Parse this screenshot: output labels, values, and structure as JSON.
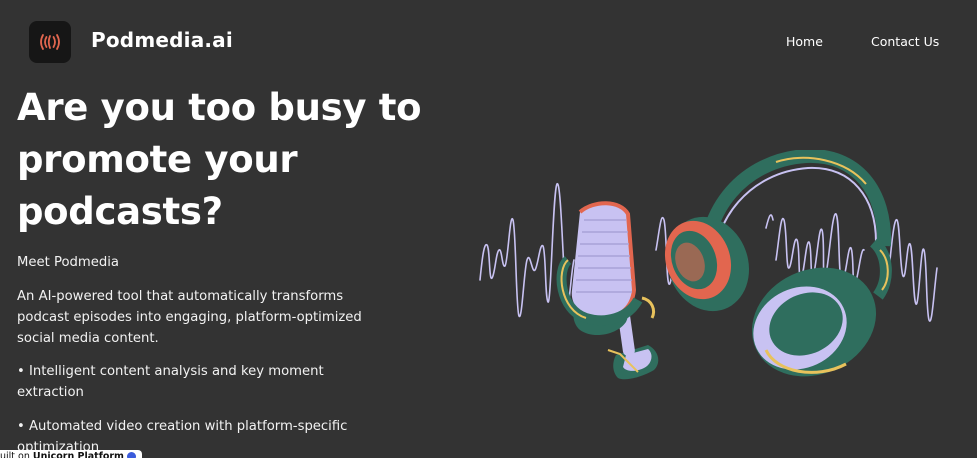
{
  "header": {
    "brand": "Podmedia.ai",
    "logo_icon": "sound-waves-icon",
    "nav": {
      "home": "Home",
      "contact": "Contact Us"
    }
  },
  "hero": {
    "headline_lines": [
      "Are you too busy to",
      "promote your",
      "podcasts?"
    ],
    "meet": "Meet Podmedia",
    "description": "An AI-powered tool that automatically transforms podcast episodes into engaging, platform-optimized social media content.",
    "bullets": [
      "• Intelligent content analysis and key moment extraction",
      "• Automated video creation with platform-specific optimization"
    ],
    "illustration_icon": "podcast-microphone-headphones-illustration"
  },
  "badge": {
    "prefix": "uilt on",
    "platform": "Unicorn Platform"
  },
  "colors": {
    "background": "#333333",
    "text": "#ffffff",
    "accent_red": "#e2664f",
    "accent_green": "#2f6e5e",
    "accent_lavender": "#c8c2f2",
    "accent_yellow": "#e8c25c"
  }
}
